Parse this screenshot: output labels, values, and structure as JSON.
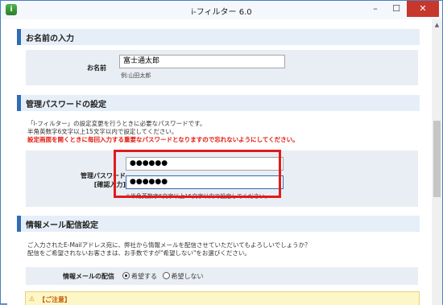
{
  "window": {
    "title": "i-フィルター 6.0",
    "minimize_glyph": "–",
    "maximize_glyph": "☐",
    "close_glyph": "✕"
  },
  "sections": {
    "name": {
      "heading": "お名前の入力",
      "label": "お名前",
      "value": "富士通太郎",
      "example": "例:山田太郎"
    },
    "password": {
      "heading": "管理パスワードの設定",
      "desc_line1": "「i-フィルター」の設定変更を行うときに必要なパスワードです。",
      "desc_line2": "半角英数字6文字以上15文字以内で設定してください。",
      "warning": "設定画面を開くときに毎回入力する重要なパスワードとなりますので忘れないようにしてください。",
      "label_line1": "管理パスワード",
      "label_line2": "[確認入力]",
      "password_value": "●●●●●●",
      "confirm_value": "●●●●●●",
      "hint": "※半角英数字6文字以上15文字以内で設定してください。"
    },
    "mail": {
      "heading": "情報メール配信設定",
      "desc_line1": "ご入力されたE-Mailアドレス宛に、弊社から情報メールを配信させていただいてもよろしいでしょうか？",
      "desc_line2": "配信をご希望されないお客さまは、お手数ですが\"希望しない\"をお選びください。",
      "label": "情報メールの配信",
      "option_yes": "希望する",
      "option_no": "希望しない",
      "selected": "希望する"
    },
    "notice": {
      "title": "【ご注意】"
    }
  },
  "colors": {
    "accent": "#2f6db5",
    "warning_text": "#e4160c",
    "highlight_box": "#e11b1b",
    "close_button": "#c7372b"
  },
  "icons": {
    "app": "i-filter-app-icon",
    "warn": "warning-icon"
  }
}
